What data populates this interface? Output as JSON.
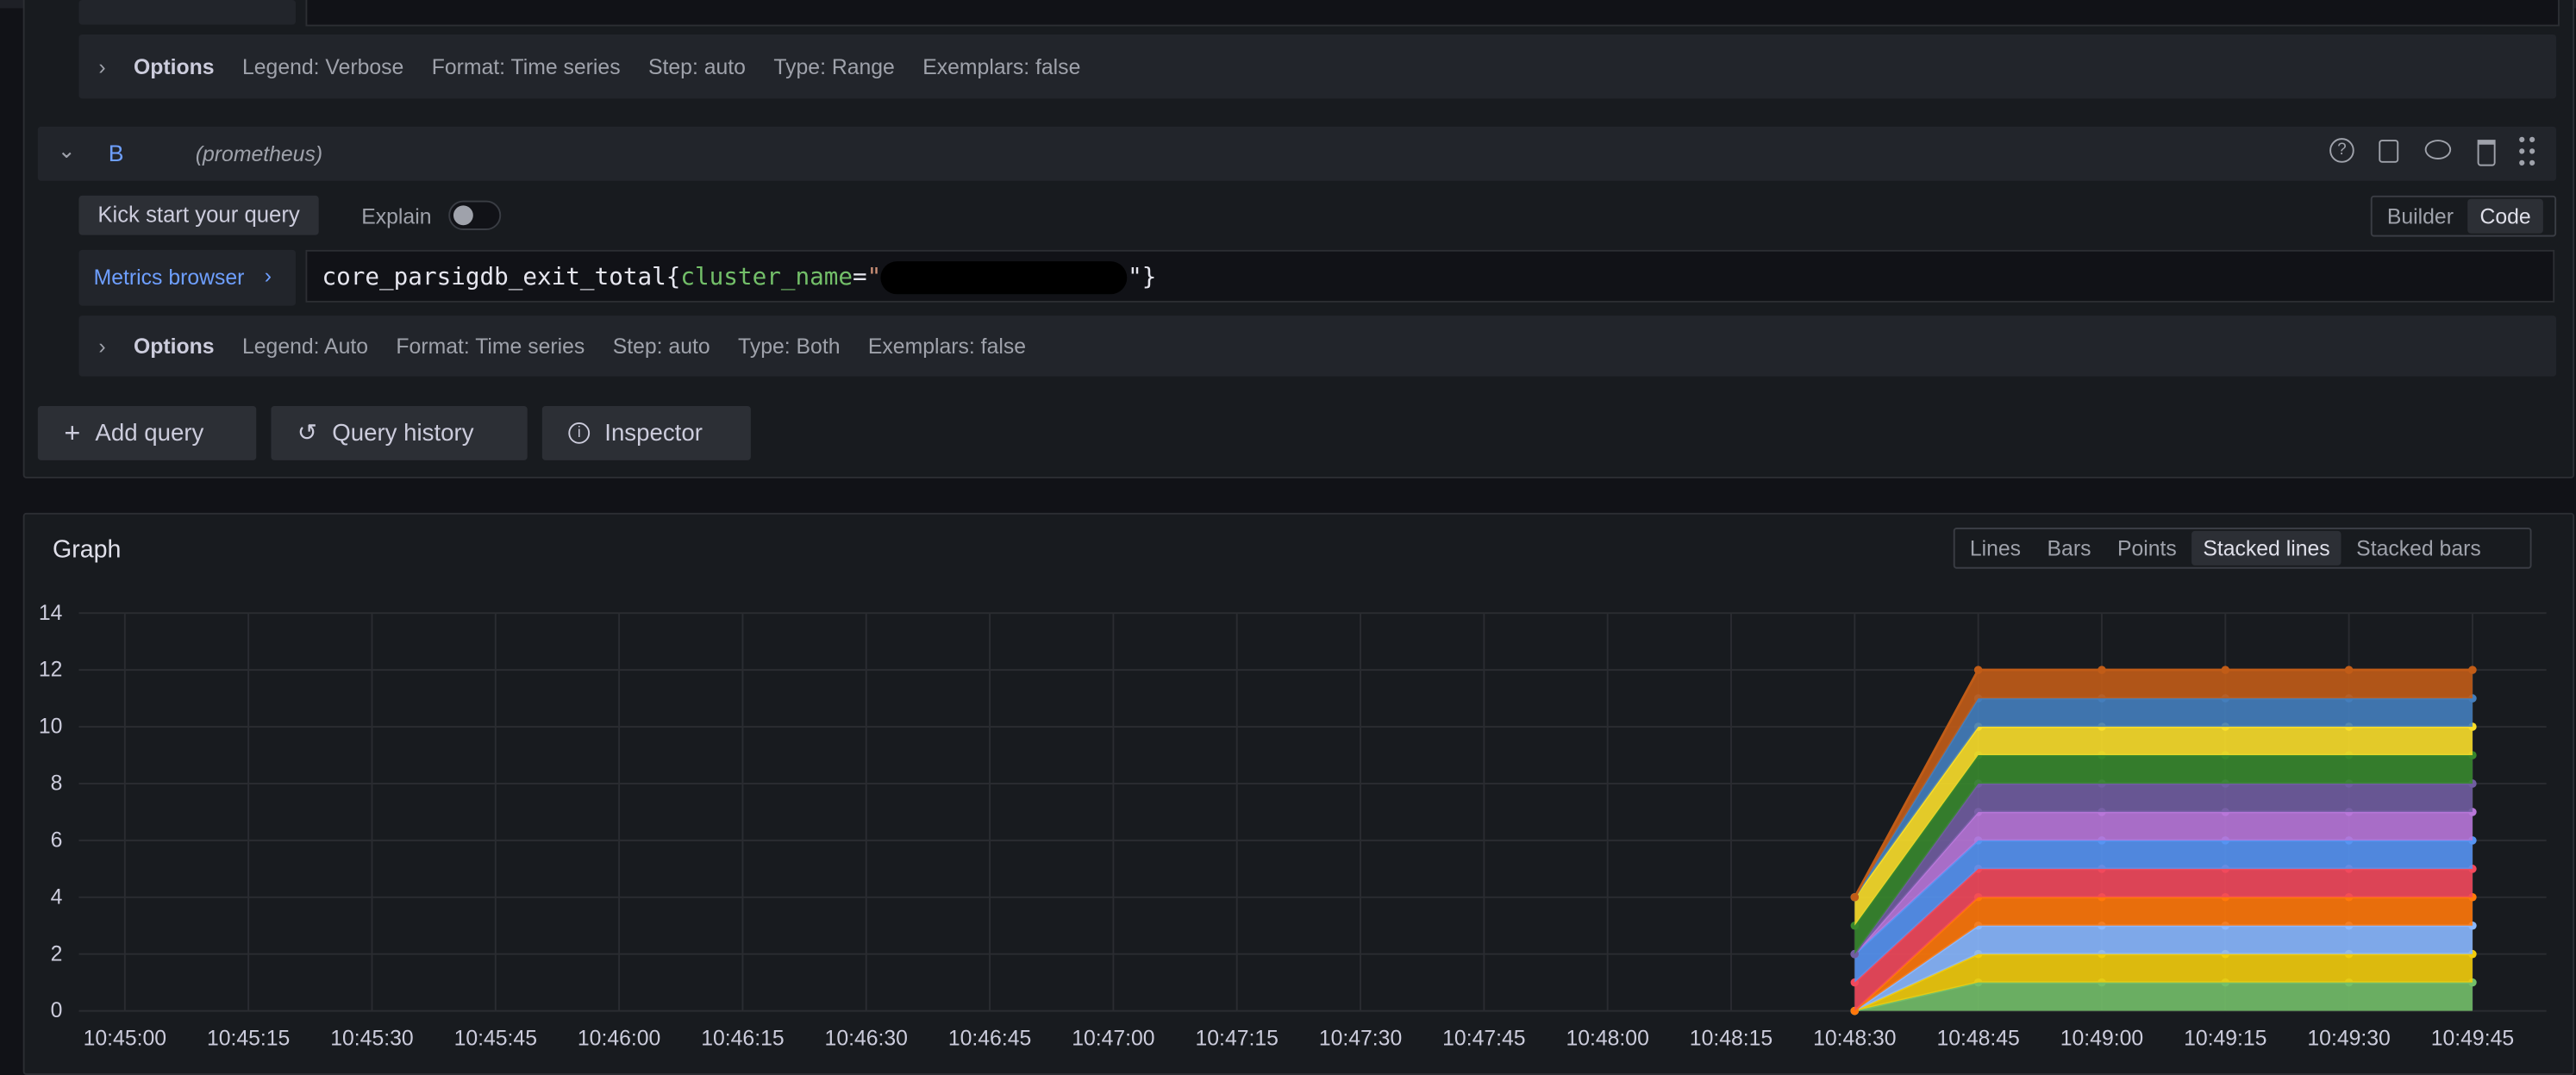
{
  "query_a": {
    "options_label": "Options",
    "options": [
      "Legend: Verbose",
      "Format: Time series",
      "Step: auto",
      "Type: Range",
      "Exemplars: false"
    ]
  },
  "query_b": {
    "ref_id": "B",
    "datasource": "(prometheus)",
    "kick_start": "Kick start your query",
    "explain_label": "Explain",
    "explain_on": false,
    "mode_builder": "Builder",
    "mode_code": "Code",
    "mode_selected": "Code",
    "metrics_browser": "Metrics browser",
    "query_metric": "core_parsigdb_exit_total{",
    "query_label": "cluster_name",
    "query_eq": "=",
    "query_quote_open": "\"",
    "query_tail": "\"}",
    "options_label": "Options",
    "options": [
      "Legend: Auto",
      "Format: Time series",
      "Step: auto",
      "Type: Both",
      "Exemplars: false"
    ]
  },
  "actions": {
    "add_query": "Add query",
    "query_history": "Query history",
    "inspector": "Inspector"
  },
  "graph": {
    "title": "Graph",
    "view_modes": [
      "Lines",
      "Bars",
      "Points",
      "Stacked lines",
      "Stacked bars"
    ],
    "selected_view": "Stacked lines"
  },
  "chart_data": {
    "type": "area",
    "stacked": true,
    "grid": true,
    "ylim": [
      0,
      14
    ],
    "yticks": [
      "0",
      "2",
      "4",
      "6",
      "8",
      "10",
      "12",
      "14"
    ],
    "xticks": [
      "10:45:00",
      "10:45:15",
      "10:45:30",
      "10:45:45",
      "10:46:00",
      "10:46:15",
      "10:46:30",
      "10:46:45",
      "10:47:00",
      "10:47:15",
      "10:47:30",
      "10:47:45",
      "10:48:00",
      "10:48:15",
      "10:48:30",
      "10:48:45",
      "10:49:00",
      "10:49:15",
      "10:49:30",
      "10:49:45"
    ],
    "x": [
      "10:48:30",
      "10:48:45",
      "10:49:00",
      "10:49:15",
      "10:49:30",
      "10:49:45"
    ],
    "series": [
      {
        "color": "#73BF69",
        "values": [
          0,
          1,
          1,
          1,
          1,
          1
        ]
      },
      {
        "color": "#F2CC0C",
        "values": [
          0,
          1,
          1,
          1,
          1,
          1
        ]
      },
      {
        "color": "#8AB8FF",
        "values": [
          0,
          1,
          1,
          1,
          1,
          1
        ]
      },
      {
        "color": "#FF780A",
        "values": [
          0,
          1,
          1,
          1,
          1,
          1
        ]
      },
      {
        "color": "#F2495C",
        "values": [
          1,
          1,
          1,
          1,
          1,
          1
        ]
      },
      {
        "color": "#5794F2",
        "values": [
          1,
          1,
          1,
          1,
          1,
          1
        ]
      },
      {
        "color": "#B877D9",
        "values": [
          0,
          1,
          1,
          1,
          1,
          1
        ]
      },
      {
        "color": "#705DA0",
        "values": [
          0,
          1,
          1,
          1,
          1,
          1
        ]
      },
      {
        "color": "#37872D",
        "values": [
          1,
          1,
          1,
          1,
          1,
          1
        ]
      },
      {
        "color": "#FADE2A",
        "values": [
          1,
          1,
          1,
          1,
          1,
          1
        ]
      },
      {
        "color": "#447EBC",
        "values": [
          0,
          1,
          1,
          1,
          1,
          1
        ]
      },
      {
        "color": "#C15C17",
        "values": [
          0,
          1,
          1,
          1,
          1,
          1
        ]
      }
    ]
  }
}
